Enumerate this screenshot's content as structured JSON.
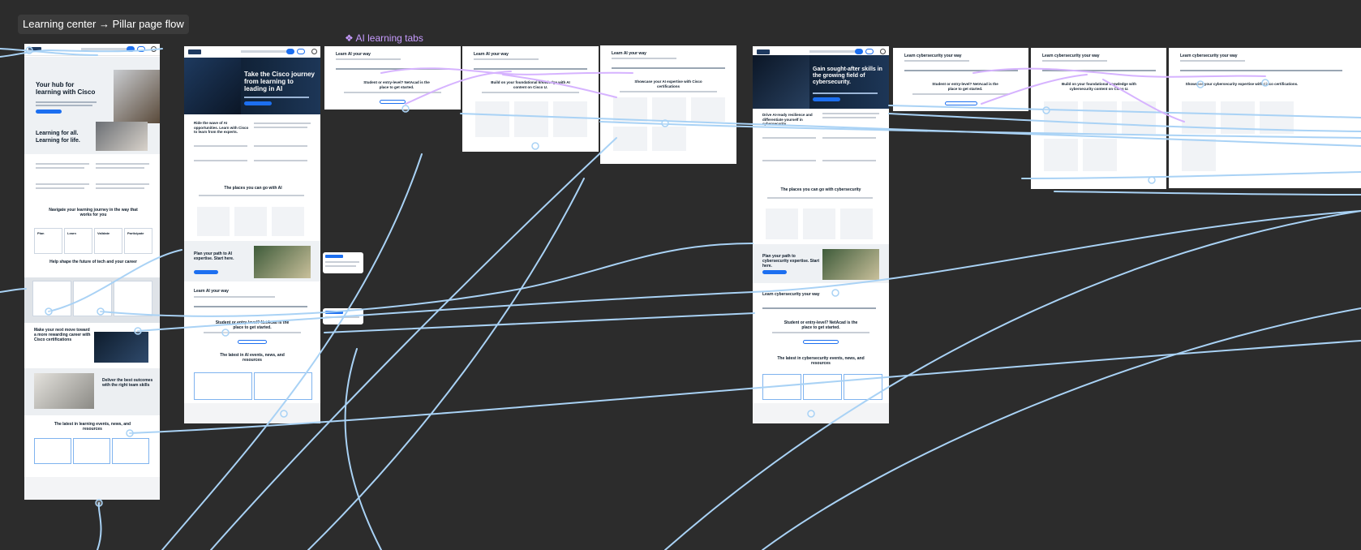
{
  "canvas": {
    "flow_title": "Learning center → Pillar page flow",
    "section_label": "AI learning tabs",
    "section_icon": "component-icon"
  },
  "frames": {
    "learning_center": {
      "hero_title": "Your hub for learning with Cisco",
      "tagline": "Learning for all. Learning for life.",
      "journey_heading": "Navigate your learning journey in the way that works for you",
      "journey_cards": [
        "Plan",
        "Learn",
        "Validate",
        "Participate"
      ],
      "shape_heading": "Help shape the future of tech and your career",
      "next_move_heading": "Make your next move toward a more rewarding career with Cisco certifications",
      "team_heading": "Deliver the best outcomes with the right team skills",
      "latest_heading": "The latest in learning events, news, and resources"
    },
    "ai_pillar": {
      "hero_title": "Take the Cisco journey from learning to leading in AI",
      "ride_heading": "Ride the wave of AI opportunities. Learn with Cisco to learn from the experts.",
      "places_heading": "The places you can go with AI",
      "path_heading": "Plan your path to AI expertise. Start here.",
      "learn_heading": "Learn AI your way",
      "student_heading": "Student or entry-level? NetAcad is the place to get started.",
      "latest_heading": "The latest in AI events, news, and resources"
    },
    "ai_tabs": {
      "tab1_title": "Learn AI your way",
      "tab1_body": "Student or entry-level? NetAcad is the place to get started.",
      "tab2_title": "Learn AI your way",
      "tab2_body": "Build on your foundational knowledge with AI content on Cisco U.",
      "tab3_title": "Learn AI your way",
      "tab3_body": "Showcase your AI expertise with Cisco certifications"
    },
    "cyber_pillar": {
      "hero_title": "Gain sought-after skills in the growing field of cybersecurity.",
      "drive_heading": "Drive AI-ready resilience and differentiate yourself in cybersecurity",
      "places_heading": "The places you can go with cybersecurity",
      "path_heading": "Plan your path to cybersecurity expertise. Start here.",
      "learn_heading": "Learn cybersecurity your way",
      "student_heading": "Student or entry-level? NetAcad is the place to get started.",
      "latest_heading": "The latest in cybersecurity events, news, and resources"
    },
    "cyber_tabs": {
      "tab1_title": "Learn cybersecurity your way",
      "tab1_body": "Student or entry-level? NetAcad is the place to get started.",
      "tab2_title": "Learn cybersecurity your way",
      "tab2_body": "Build on your foundational knowledge with cybersecurity content on Cisco U.",
      "tab3_title": "Learn cybersecurity your way",
      "tab3_body": "Showcase your cybersecurity expertise with Cisco certifications."
    }
  },
  "colors": {
    "canvas": "#2c2c2c",
    "connector": "#a9d2f5",
    "accent_purple": "#c79bff",
    "brand_blue": "#1c6ff0"
  }
}
